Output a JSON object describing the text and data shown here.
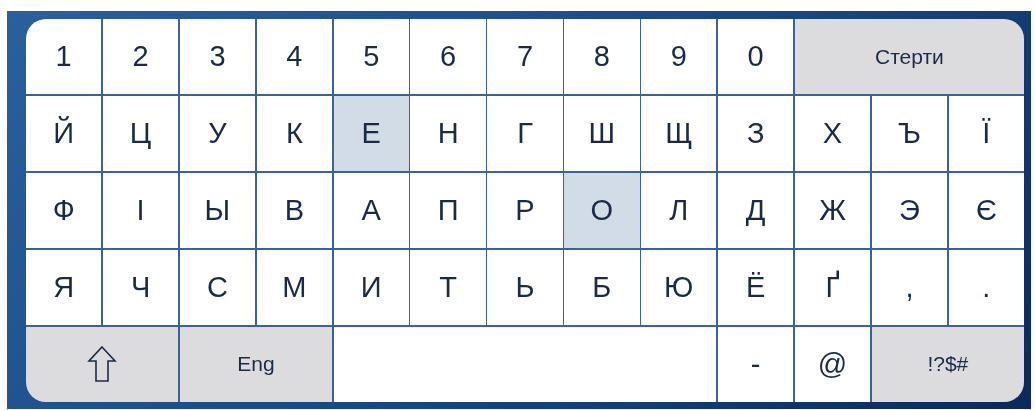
{
  "keyboard": {
    "rows": [
      {
        "keys": [
          {
            "kind": "char",
            "label": "1",
            "selected": false
          },
          {
            "kind": "char",
            "label": "2",
            "selected": false
          },
          {
            "kind": "char",
            "label": "3",
            "selected": false
          },
          {
            "kind": "char",
            "label": "4",
            "selected": false
          },
          {
            "kind": "char",
            "label": "5",
            "selected": false
          },
          {
            "kind": "char",
            "label": "6",
            "selected": false
          },
          {
            "kind": "char",
            "label": "7",
            "selected": false
          },
          {
            "kind": "char",
            "label": "8",
            "selected": false
          },
          {
            "kind": "char",
            "label": "9",
            "selected": false
          },
          {
            "kind": "char",
            "label": "0",
            "selected": false
          },
          {
            "kind": "backspace",
            "label": "Стерти",
            "selected": false
          }
        ]
      },
      {
        "keys": [
          {
            "kind": "char",
            "label": "Й",
            "selected": false
          },
          {
            "kind": "char",
            "label": "Ц",
            "selected": false
          },
          {
            "kind": "char",
            "label": "У",
            "selected": false
          },
          {
            "kind": "char",
            "label": "К",
            "selected": false
          },
          {
            "kind": "char",
            "label": "Е",
            "selected": true
          },
          {
            "kind": "char",
            "label": "Н",
            "selected": false
          },
          {
            "kind": "char",
            "label": "Г",
            "selected": false
          },
          {
            "kind": "char",
            "label": "Ш",
            "selected": false
          },
          {
            "kind": "char",
            "label": "Щ",
            "selected": false
          },
          {
            "kind": "char",
            "label": "З",
            "selected": false
          },
          {
            "kind": "char",
            "label": "Х",
            "selected": false
          },
          {
            "kind": "char",
            "label": "Ъ",
            "selected": false
          },
          {
            "kind": "char",
            "label": "Ї",
            "selected": false
          }
        ]
      },
      {
        "keys": [
          {
            "kind": "char",
            "label": "Ф",
            "selected": false
          },
          {
            "kind": "char",
            "label": "І",
            "selected": false
          },
          {
            "kind": "char",
            "label": "Ы",
            "selected": false
          },
          {
            "kind": "char",
            "label": "В",
            "selected": false
          },
          {
            "kind": "char",
            "label": "А",
            "selected": false
          },
          {
            "kind": "char",
            "label": "П",
            "selected": false
          },
          {
            "kind": "char",
            "label": "Р",
            "selected": false
          },
          {
            "kind": "char",
            "label": "О",
            "selected": true
          },
          {
            "kind": "char",
            "label": "Л",
            "selected": false
          },
          {
            "kind": "char",
            "label": "Д",
            "selected": false
          },
          {
            "kind": "char",
            "label": "Ж",
            "selected": false
          },
          {
            "kind": "char",
            "label": "Э",
            "selected": false
          },
          {
            "kind": "char",
            "label": "Є",
            "selected": false
          }
        ]
      },
      {
        "keys": [
          {
            "kind": "char",
            "label": "Я",
            "selected": false
          },
          {
            "kind": "char",
            "label": "Ч",
            "selected": false
          },
          {
            "kind": "char",
            "label": "С",
            "selected": false
          },
          {
            "kind": "char",
            "label": "М",
            "selected": false
          },
          {
            "kind": "char",
            "label": "И",
            "selected": false
          },
          {
            "kind": "char",
            "label": "Т",
            "selected": false
          },
          {
            "kind": "char",
            "label": "Ь",
            "selected": false
          },
          {
            "kind": "char",
            "label": "Б",
            "selected": false
          },
          {
            "kind": "char",
            "label": "Ю",
            "selected": false
          },
          {
            "kind": "char",
            "label": "Ё",
            "selected": false
          },
          {
            "kind": "char",
            "label": "Ґ",
            "selected": false
          },
          {
            "kind": "char",
            "label": ",",
            "selected": false
          },
          {
            "kind": "char",
            "label": ".",
            "selected": false
          }
        ]
      },
      {
        "keys": [
          {
            "kind": "shift",
            "selected": false
          },
          {
            "kind": "function",
            "label": "Eng",
            "selected": false
          },
          {
            "kind": "space",
            "selected": false
          },
          {
            "kind": "char",
            "label": "-",
            "selected": false
          },
          {
            "kind": "char",
            "label": "@",
            "selected": false
          },
          {
            "kind": "function",
            "label": "!?$#",
            "selected": false
          }
        ]
      }
    ]
  }
}
